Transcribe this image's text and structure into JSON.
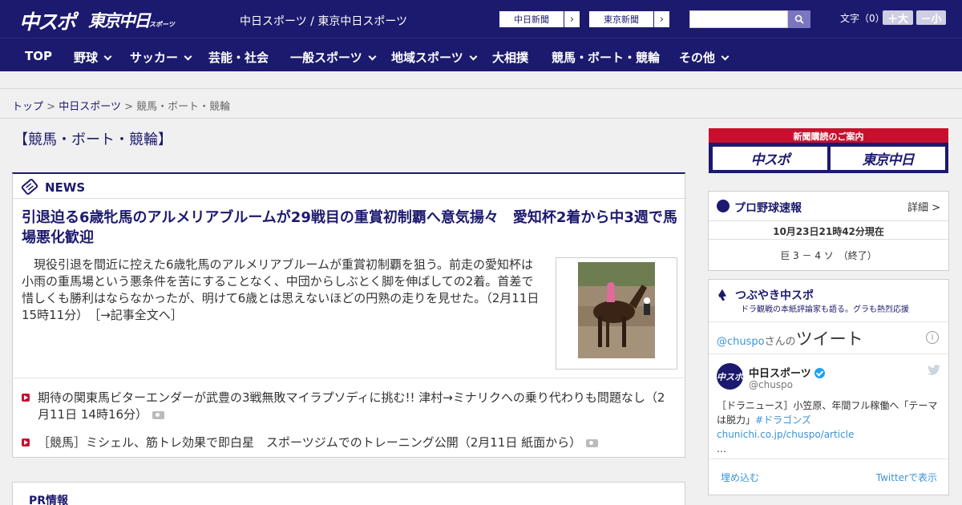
{
  "header": {
    "logo_main": "中スポ",
    "logo_tokyo": "東京中日",
    "logo_tokyo_small": "スポーツ",
    "site_links": "中日スポーツ / 東京中日スポーツ",
    "btn_chunichi": "中日新聞",
    "btn_tokyo": "東京新聞",
    "search_placeholder": "",
    "fontsize_label": "文字（0）",
    "fontsize_plus": "＋大",
    "fontsize_minus": "－小"
  },
  "nav": [
    {
      "label": "TOP"
    },
    {
      "label": "野球"
    },
    {
      "label": "サッカー"
    },
    {
      "label": "芸能・社会"
    },
    {
      "label": "一般スポーツ"
    },
    {
      "label": "地域スポーツ"
    },
    {
      "label": "大相撲"
    },
    {
      "label": "競馬・ボート・競輪"
    },
    {
      "label": "その他"
    }
  ],
  "breadcrumb": {
    "top": "トップ",
    "sep": ">",
    "section": "中日スポーツ",
    "current": "競馬・ボート・競輪"
  },
  "page_title": "【競馬・ボート・競輪】",
  "news": {
    "heading": "NEWS",
    "headline": "引退迫る6歳牝馬のアルメリアブルームが29戦目の重賞初制覇へ意気揚々　愛知杯2着から中3週で馬場悪化歓迎",
    "lead": "　現役引退を間近に控えた6歳牝馬のアルメリアブルームが重賞初制覇を狙う。前走の愛知杯は小雨の重馬場という悪条件を苦にすることなく、中団からしぶとく脚を伸ばしての2着。首差で惜しくも勝利はならなかったが、明けて6歳とは思えないほどの円熟の走りを見せた。（2月11日 15時11分）",
    "more": "［→記事全文へ］",
    "items": [
      {
        "text": "期待の関東馬ビターエンダーが武豊の3戦無敗マイラプソディに挑む!! 津村→ミナリクへの乗り代わりも問題なし（2月11日 14時16分）"
      },
      {
        "text": "［競馬］ミシェル、筋トレ効果で即白星　スポーツジムでのトレーニング公開（2月11日 紙面から）"
      }
    ]
  },
  "pr": {
    "heading": "PR情報"
  },
  "sidebar": {
    "subscribe_label": "新聞購読のご案内",
    "subscribe_chuspo": "中スポ",
    "subscribe_tokyo": "東京中日",
    "baseball_title": "プロ野球速報",
    "baseball_detail": "詳細 >",
    "baseball_time": "10月23日21時42分現在",
    "baseball_score": "巨 3 － 4 ソ　（終了）",
    "tweet_title": "つぶやき中スポ",
    "tweet_sub": "ドラ観戦の本紙評論家も語る。グラも熱烈応援",
    "tweet_handle": "@chuspo",
    "tweet_san": "さんの",
    "tweet_word": "ツイート",
    "tweet_name": "中日スポーツ",
    "tweet_sn": "@chuspo",
    "tweet_text_a": "［ドラニュース］小笠原、年間フル稼働へ「テーマは脱力」",
    "tweet_text_b": "#ドラゴンズ",
    "tweet_text_c": "chunichi.co.jp/chuspo/article",
    "tweet_text_d": "…",
    "tweet_embed": "埋め込む",
    "tweet_view": "Twitterで表示"
  },
  "colors": {
    "brand": "#1c1a6e",
    "accent_red": "#c8102e",
    "link_blue": "#3b94d9"
  }
}
